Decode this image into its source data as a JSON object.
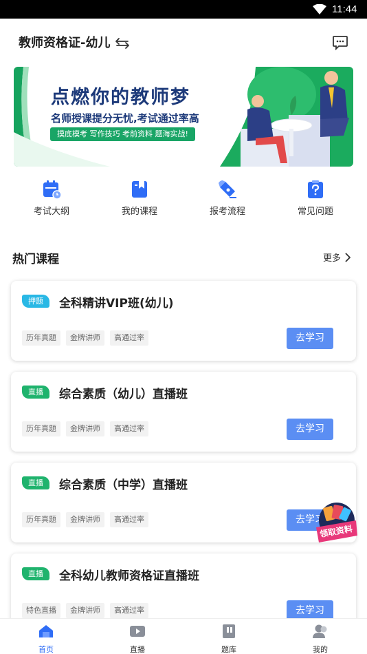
{
  "status": {
    "time": "11:44"
  },
  "header": {
    "title": "教师资格证-幼儿"
  },
  "banner": {
    "headline": "点燃你的教师梦",
    "subline": "名师授课提分无忧,考试通过率高",
    "pill": "摸底模考 写作技巧 考前资料 题海实战!"
  },
  "quick": [
    {
      "label": "考试大纲",
      "icon": "calendar-icon"
    },
    {
      "label": "我的课程",
      "icon": "bookmark-icon"
    },
    {
      "label": "报考流程",
      "icon": "pen-icon"
    },
    {
      "label": "常见问题",
      "icon": "question-icon"
    }
  ],
  "section": {
    "title": "热门课程",
    "more": "更多"
  },
  "courses": [
    {
      "badge": "押题",
      "badge_color": "#29b8e5",
      "title": "全科精讲VIP班(幼儿)",
      "tags": [
        "历年真题",
        "金牌讲师",
        "高通过率"
      ],
      "button": "去学习"
    },
    {
      "badge": "直播",
      "badge_color": "#1fb36d",
      "title": "综合素质（幼儿）直播班",
      "tags": [
        "历年真题",
        "金牌讲师",
        "高通过率"
      ],
      "button": "去学习"
    },
    {
      "badge": "直播",
      "badge_color": "#1fb36d",
      "title": "综合素质（中学）直播班",
      "tags": [
        "历年真题",
        "金牌讲师",
        "高通过率"
      ],
      "button": "去学习"
    },
    {
      "badge": "直播",
      "badge_color": "#1fb36d",
      "title": "全科幼儿教师资格证直播班",
      "tags": [
        "特色直播",
        "金牌讲师",
        "高通过率"
      ],
      "button": "去学习"
    }
  ],
  "float_badge": "领取资料",
  "tabs": [
    {
      "label": "首页",
      "icon": "home-icon",
      "active": true
    },
    {
      "label": "直播",
      "icon": "play-icon",
      "active": false
    },
    {
      "label": "题库",
      "icon": "book-icon",
      "active": false
    },
    {
      "label": "我的",
      "icon": "user-icon",
      "active": false
    }
  ],
  "colors": {
    "accent": "#2f6df6",
    "button": "#5b8ef3",
    "green": "#19a566"
  }
}
